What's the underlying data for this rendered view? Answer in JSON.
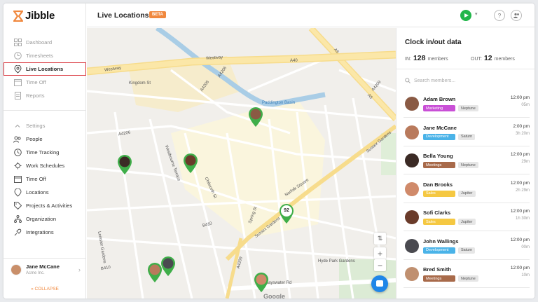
{
  "app": {
    "logo_text": "Jibble",
    "nav_primary": [
      {
        "label": "Dashboard",
        "icon": "dashboard-icon"
      },
      {
        "label": "Timesheets",
        "icon": "clock-icon"
      },
      {
        "label": "Live Locations",
        "icon": "location-pin-icon",
        "active": true
      },
      {
        "label": "Time Off",
        "icon": "calendar-icon"
      },
      {
        "label": "Reports",
        "icon": "reports-icon"
      }
    ],
    "nav_settings": [
      {
        "label": "Settings",
        "icon": "chevron-up-icon"
      },
      {
        "label": "People",
        "icon": "people-icon"
      },
      {
        "label": "Time Tracking",
        "icon": "time-tracking-icon"
      },
      {
        "label": "Work Schedules",
        "icon": "schedules-icon"
      },
      {
        "label": "Time Off",
        "icon": "calendar-icon"
      },
      {
        "label": "Locations",
        "icon": "location-pin-icon"
      },
      {
        "label": "Projects & Activities",
        "icon": "tag-icon"
      },
      {
        "label": "Organization",
        "icon": "organization-icon"
      },
      {
        "label": "Integrations",
        "icon": "plug-icon"
      }
    ],
    "user": {
      "name": "Jane McCane",
      "org": "Acme Inc."
    },
    "collapse_label": "COLLAPSE"
  },
  "header": {
    "title": "Live Locations",
    "badge": "BETA",
    "accent": "#f0883e"
  },
  "map": {
    "labels": [
      "Westway",
      "A40",
      "Westway",
      "Kingdom St",
      "A4206",
      "A4206",
      "A4206",
      "B410",
      "B410",
      "A5",
      "A5",
      "Paddington Basin",
      "Sussex Gardens",
      "Sussex Gardens",
      "Spring St",
      "A4209",
      "A4209",
      "Bayswater Rd",
      "Hyde Park Gardens",
      "Leinster Gardens",
      "Westbourne Terrace",
      "Chilworth St",
      "Norfolk Square"
    ],
    "cluster_count": "92",
    "google_label": "Google"
  },
  "panel": {
    "title": "Clock in/out data",
    "in_label": "IN:",
    "in_count": "128",
    "in_unit": "members",
    "out_label": "OUT:",
    "out_count": "12",
    "out_unit": "members",
    "search_placeholder": "Search members...",
    "members": [
      {
        "name": "Adam Brown",
        "tag1": "Marketing",
        "tag1_color": "#c94fd6",
        "tag2": "Neptune",
        "time": "12:00 pm",
        "dur": "05m",
        "avatar": "#8a5a44"
      },
      {
        "name": "Jane McCane",
        "tag1": "Development",
        "tag1_color": "#4ab3e8",
        "tag2": "Saturn",
        "time": "2:00 pm",
        "dur": "3h 20m",
        "avatar": "#b97a5c"
      },
      {
        "name": "Bella Young",
        "tag1": "Meetings",
        "tag1_color": "#a86a4a",
        "tag2": "Neptune",
        "time": "12:00 pm",
        "dur": "29m",
        "avatar": "#3b2a25"
      },
      {
        "name": "Dan Brooks",
        "tag1": "Sales",
        "tag1_color": "#f5c842",
        "tag2": "Jupiter",
        "time": "12:00 pm",
        "dur": "2h 29m",
        "avatar": "#d08a6a"
      },
      {
        "name": "Sofi Clarks",
        "tag1": "Sales",
        "tag1_color": "#f5c842",
        "tag2": "Jupiter",
        "time": "12:00 pm",
        "dur": "1h 30m",
        "avatar": "#6a3b2a"
      },
      {
        "name": "John Wallings",
        "tag1": "Development",
        "tag1_color": "#4ab3e8",
        "tag2": "Saturn",
        "time": "12:00 pm",
        "dur": "00m",
        "avatar": "#4a4a50"
      },
      {
        "name": "Bred Smith",
        "tag1": "Meetings",
        "tag1_color": "#a86a4a",
        "tag2": "Neptune",
        "time": "12:00 pm",
        "dur": "10m",
        "avatar": "#c09070"
      }
    ]
  }
}
